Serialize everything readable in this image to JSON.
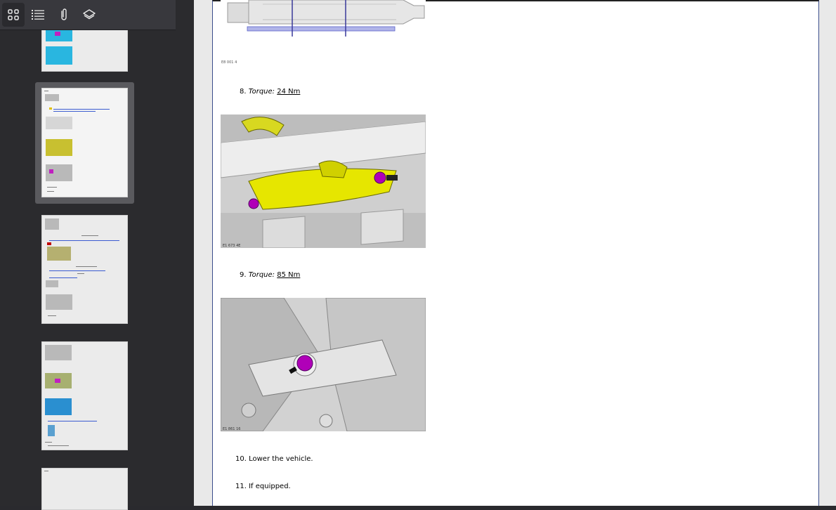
{
  "toolbar": {
    "buttons": [
      {
        "name": "thumbnails-icon",
        "active": true
      },
      {
        "name": "outline-icon",
        "active": false
      },
      {
        "name": "attachments-icon",
        "active": false
      },
      {
        "name": "layers-icon",
        "active": false
      }
    ]
  },
  "document": {
    "steps": [
      {
        "number": "8.",
        "label": "Torque:",
        "value": "24 Nm"
      },
      {
        "number": "9.",
        "label": "Torque:",
        "value": "85 Nm"
      },
      {
        "number": "10.",
        "text": "Lower the vehicle."
      },
      {
        "number": "11.",
        "text": "If equipped."
      }
    ],
    "figure_captions": [
      "E8 001 4",
      "E1 673 4E",
      "E1 861 16"
    ]
  },
  "colors": {
    "sidebar": "#2b2b2e",
    "toolbar": "#38383d",
    "page_border": "#3b4d8c",
    "highlight_magenta": "#b000b8",
    "highlight_yellow": "#e6e600",
    "highlight_cyan": "#20b8e8"
  }
}
